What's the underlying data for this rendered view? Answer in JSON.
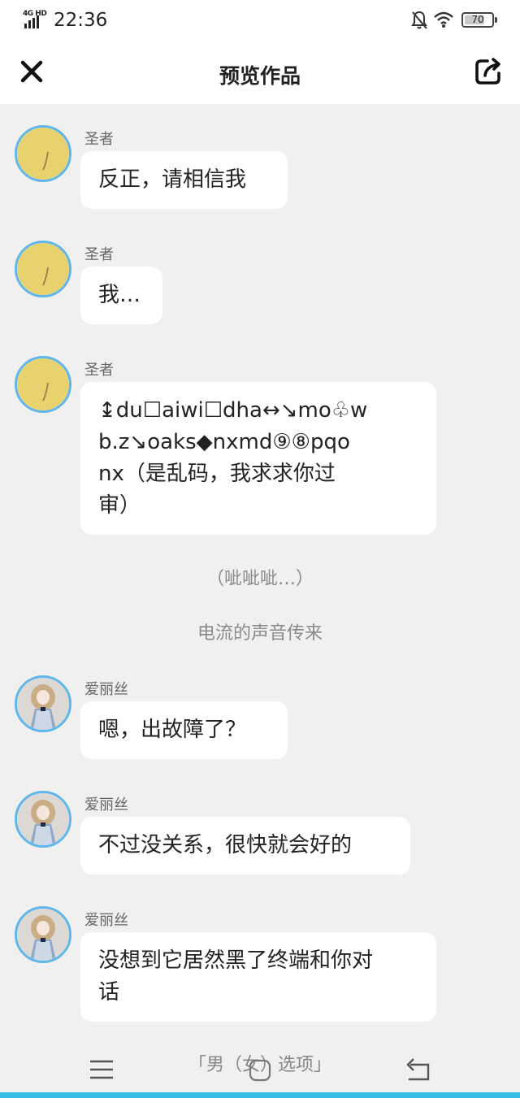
{
  "status_bar": {
    "network": "4G HD",
    "time": "22:36",
    "battery": "70"
  },
  "header": {
    "title": "预览作品",
    "close_icon": "close-icon",
    "share_icon": "share-icon"
  },
  "messages": [
    {
      "speaker": "圣者",
      "avatar": "yellow-avatar",
      "text": [
        "反正，请相信我"
      ]
    },
    {
      "speaker": "圣者",
      "avatar": "yellow-avatar",
      "text": [
        "我…"
      ]
    },
    {
      "speaker": "圣者",
      "avatar": "yellow-avatar",
      "text": [
        "↨du☐aiwi☐dha↔↘mo♧w",
        "b.z↘oaks◆nxmd⑨⑧pqo",
        "nx（是乱码，我求求你过",
        "审）"
      ]
    },
    {
      "speaker": "爱丽丝",
      "avatar": "doll-avatar",
      "text": [
        "嗯，出故障了？"
      ]
    },
    {
      "speaker": "爱丽丝",
      "avatar": "doll-avatar",
      "text": [
        "不过没关系，很快就会好的"
      ]
    },
    {
      "speaker": "爱丽丝",
      "avatar": "doll-avatar",
      "text": [
        "没想到它居然黑了终端和你对",
        "话"
      ]
    }
  ],
  "narration": [
    "（呲呲呲…）",
    "电流的声音传来"
  ],
  "bottom_bar": {
    "options_label": "「男（女）选项」",
    "menu_icon": "menu-icon",
    "undo_icon": "undo-icon"
  },
  "colors": {
    "avatar_border": "#5fb6ea",
    "yellow_avatar": "#e8d26e",
    "accent_line": "#34c0e6",
    "background": "#f0f0f0"
  }
}
